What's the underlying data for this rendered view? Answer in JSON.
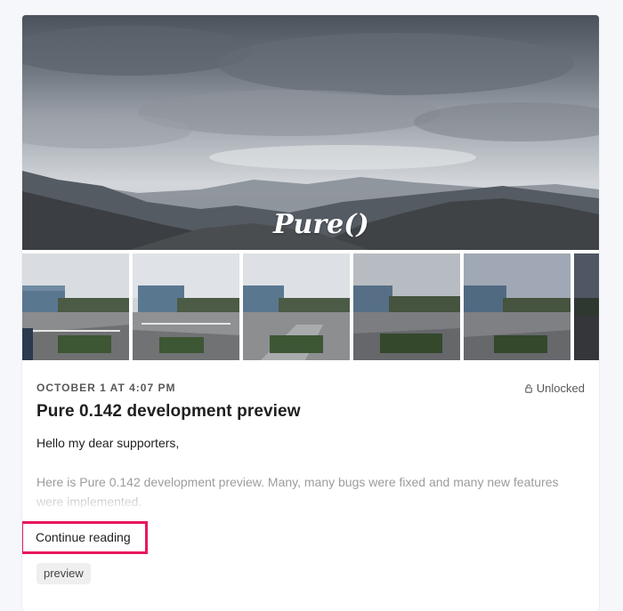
{
  "post": {
    "hero_logo_text": "Pure()",
    "date": "OCTOBER 1 AT 4:07 PM",
    "access_label": "Unlocked",
    "title": "Pure 0.142 development preview",
    "greeting": "Hello my dear supporters,",
    "excerpt": "Here is Pure 0.142 development preview. Many, many bugs were fixed and many new features were implemented.",
    "continue_label": "Continue reading",
    "tags": [
      "preview"
    ]
  },
  "thumbnails": {
    "count_visible": 6,
    "next_arrow": "›",
    "icons": [
      "image-thumbnail",
      "chevron-right-icon",
      "lock-icon"
    ]
  },
  "colors": {
    "highlight_border": "#e8175d",
    "page_background": "#f6f7fb",
    "tag_background": "#efefef"
  }
}
